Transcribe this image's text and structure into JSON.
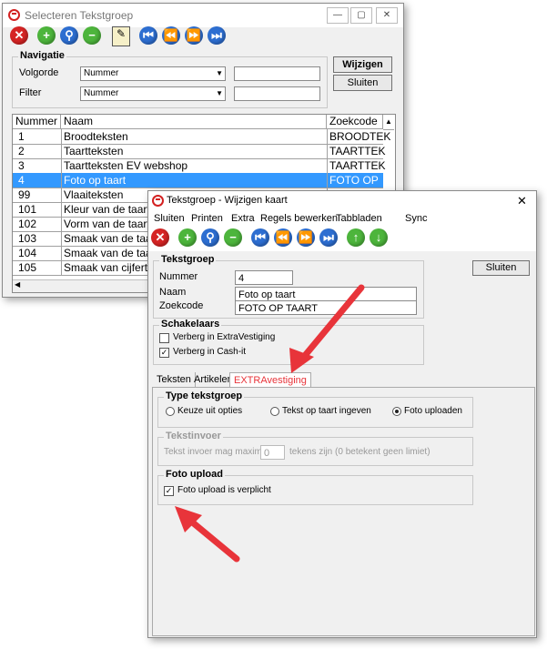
{
  "back_window": {
    "title": "Selecteren Tekstgroep",
    "nav_group_title": "Navigatie",
    "volgorde_label": "Volgorde",
    "volgorde_value": "Nummer",
    "filter_label": "Filter",
    "filter_value": "Nummer",
    "wijzigen_button": "Wijzigen",
    "sluiten_button": "Sluiten",
    "columns": [
      "Nummer",
      "Naam",
      "Zoekcode"
    ],
    "rows": [
      {
        "nummer": "1",
        "naam": "Broodteksten",
        "zoekcode": "BROODTEK"
      },
      {
        "nummer": "2",
        "naam": "Taartteksten",
        "zoekcode": "TAARTTEK"
      },
      {
        "nummer": "3",
        "naam": "Taartteksten EV webshop",
        "zoekcode": "TAARTTEK"
      },
      {
        "nummer": "4",
        "naam": "Foto op taart",
        "zoekcode": "FOTO OP"
      },
      {
        "nummer": "99",
        "naam": "Vlaaiteksten",
        "zoekcode": ""
      },
      {
        "nummer": "101",
        "naam": "Kleur van de taart",
        "zoekcode": ""
      },
      {
        "nummer": "102",
        "naam": "Vorm van de taart",
        "zoekcode": ""
      },
      {
        "nummer": "103",
        "naam": "Smaak van de taart",
        "zoekcode": ""
      },
      {
        "nummer": "104",
        "naam": "Smaak van de taart",
        "zoekcode": ""
      },
      {
        "nummer": "105",
        "naam": "Smaak van cijfertaart",
        "zoekcode": ""
      }
    ],
    "selected_row": 3
  },
  "front_window": {
    "title": "Tekstgroep - Wijzigen kaart",
    "menu": [
      "Sluiten",
      "Printen",
      "Extra",
      "Regels bewerken",
      "Tabbladen",
      "Sync"
    ],
    "tekstgroep_title": "Tekstgroep",
    "nummer_label": "Nummer",
    "nummer_value": "4",
    "naam_label": "Naam",
    "naam_value": "Foto op taart",
    "zoekcode_label": "Zoekcode",
    "zoekcode_value": "FOTO OP TAART",
    "sluiten_button": "Sluiten",
    "schakelaars_title": "Schakelaars",
    "cb_extravestiging": "Verberg in ExtraVestiging",
    "cb_extravestiging_checked": false,
    "cb_cashit": "Verberg in Cash-it",
    "cb_cashit_checked": true,
    "tabs": [
      "Teksten",
      "Artikelen",
      "EXTRAvestiging"
    ],
    "active_tab": 2,
    "type_title": "Type tekstgroep",
    "radio_keuze": "Keuze uit opties",
    "radio_tekst": "Tekst op taart ingeven",
    "radio_foto": "Foto uploaden",
    "radio_selected": "foto",
    "tekstinvoer_title": "Tekstinvoer",
    "tekstinvoer_prefix": "Tekst invoer mag maximaal",
    "tekstinvoer_value": "0",
    "tekstinvoer_suffix": "tekens zijn (0 betekent geen limiet)",
    "foto_title": "Foto upload",
    "cb_foto_verplicht": "Foto upload is verplicht",
    "cb_foto_verplicht_checked": true
  },
  "colors": {
    "accent_red": "#e8343a",
    "selection": "#3399ff"
  }
}
